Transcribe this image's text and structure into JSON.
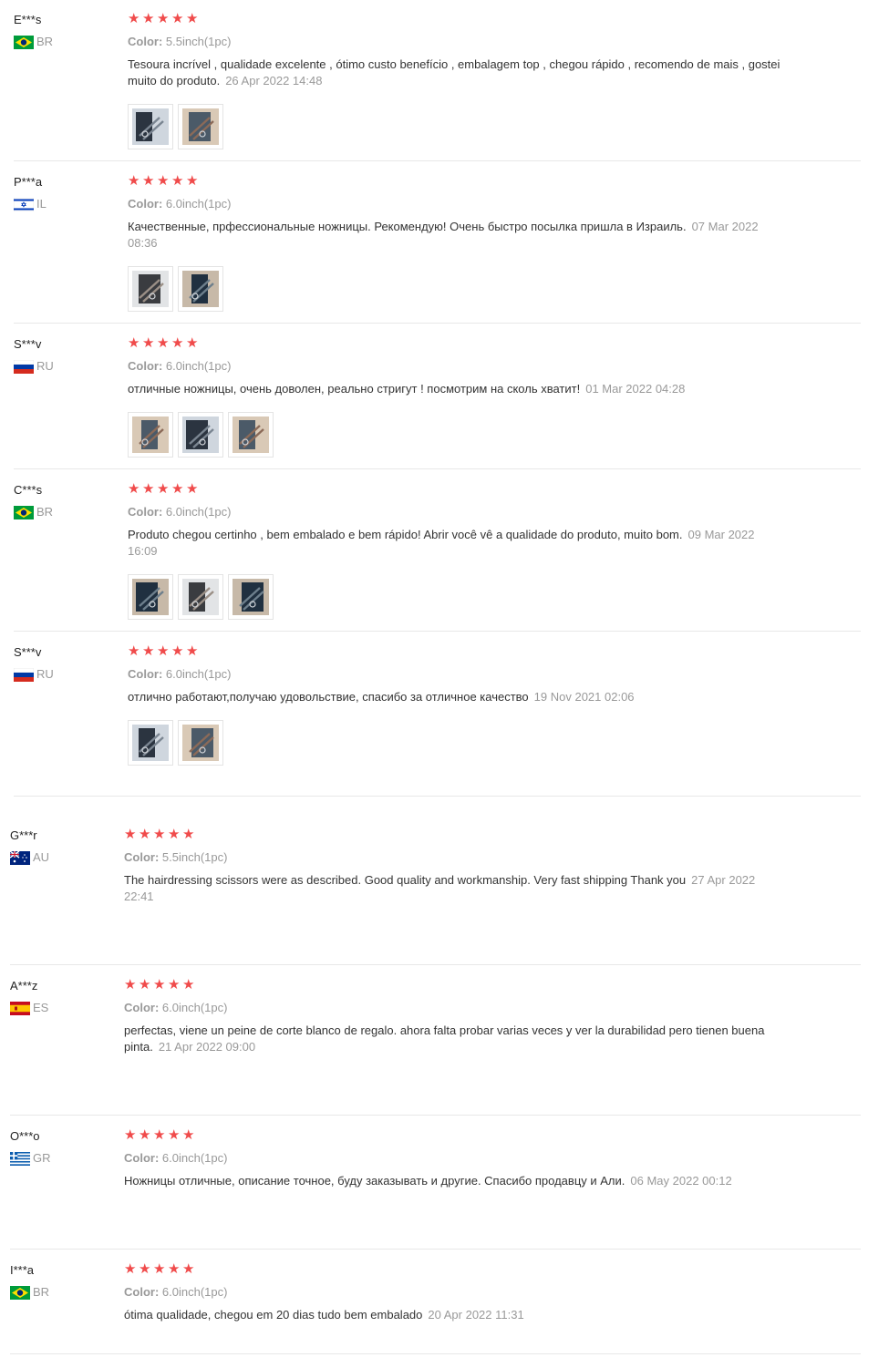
{
  "colors": {
    "star": "#f04b4b",
    "muted": "#999999",
    "text": "#333333",
    "divider": "#e8e8e8"
  },
  "reviews": [
    {
      "user": "E***s",
      "country": "BR",
      "stars": 5,
      "sku_label": "Color:",
      "sku_value": "5.5inch(1pc)",
      "text": "Tesoura incrível , qualidade excelente , ótimo custo benefício , embalagem top , chegou rápido , recomendo de mais , gostei muito do produto.",
      "date": "26 Apr 2022 14:48",
      "photos": [
        "scissors-photo",
        "scissors-photo"
      ]
    },
    {
      "user": "P***a",
      "country": "IL",
      "stars": 5,
      "sku_label": "Color:",
      "sku_value": "6.0inch(1pc)",
      "text": "Качественные, прфессиональные ножницы. Рекомендую! Очень быстро посылка пришла в Израиль.",
      "date": "07 Mar 2022 08:36",
      "photos": [
        "scissors-photo",
        "scissors-photo"
      ]
    },
    {
      "user": "S***v",
      "country": "RU",
      "stars": 5,
      "sku_label": "Color:",
      "sku_value": "6.0inch(1pc)",
      "text": "отличные ножницы, очень доволен, реально стригут ! посмотрим на сколь хватит!",
      "date": "01 Mar 2022 04:28",
      "photos": [
        "scissors-photo",
        "scissors-photo",
        "scissors-photo"
      ]
    },
    {
      "user": "C***s",
      "country": "BR",
      "stars": 5,
      "sku_label": "Color:",
      "sku_value": "6.0inch(1pc)",
      "text": "Produto chegou certinho , bem embalado e bem rápido! Abrir você vê a qualidade do produto, muito bom.",
      "date": "09 Mar 2022 16:09",
      "photos": [
        "scissors-photo",
        "scissors-photo",
        "scissors-photo"
      ]
    },
    {
      "user": "S***v",
      "country": "RU",
      "stars": 5,
      "sku_label": "Color:",
      "sku_value": "6.0inch(1pc)",
      "text": "отлично работают,получаю удовольствие, спасибо за отличное качество",
      "date": "19 Nov 2021 02:06",
      "photos": [
        "scissors-photo",
        "scissors-photo"
      ]
    },
    {
      "user": "G***r",
      "country": "AU",
      "stars": 5,
      "sku_label": "Color:",
      "sku_value": "5.5inch(1pc)",
      "text": "The hairdressing scissors were as described. Good quality and workmanship. Very fast shipping Thank you",
      "date": "27 Apr 2022 22:41",
      "photos": []
    },
    {
      "user": "A***z",
      "country": "ES",
      "stars": 5,
      "sku_label": "Color:",
      "sku_value": "6.0inch(1pc)",
      "text": "perfectas, viene un peine de corte blanco de regalo. ahora falta probar varias veces y ver la durabilidad pero tienen buena pinta.",
      "date": "21 Apr 2022 09:00",
      "photos": []
    },
    {
      "user": "O***o",
      "country": "GR",
      "stars": 5,
      "sku_label": "Color:",
      "sku_value": "6.0inch(1pc)",
      "text": "Ножницы отличные, описание точное, буду заказывать и другие. Спасибо продавцу и Али.",
      "date": "06 May 2022 00:12",
      "photos": []
    },
    {
      "user": "I***a",
      "country": "BR",
      "stars": 5,
      "sku_label": "Color:",
      "sku_value": "6.0inch(1pc)",
      "text": "ótima qualidade, chegou em 20 dias tudo bem embalado",
      "date": "20 Apr 2022 11:31",
      "photos": []
    }
  ]
}
